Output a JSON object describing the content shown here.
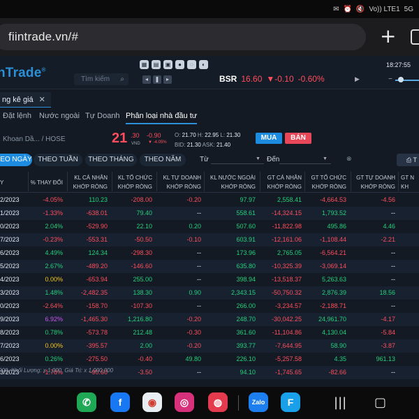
{
  "status_bar": {
    "icons": [
      "✉",
      "⏰",
      "🔇"
    ],
    "network": "Vo)) LTE1",
    "signal": "5G"
  },
  "browser": {
    "url": "fiintrade.vn/#"
  },
  "app": {
    "logo": "nTrade",
    "clock": "18:27:55",
    "search_placeholder": "Tìm kiếm",
    "ticker": {
      "symbol": "BSR",
      "price": "16.60",
      "change": "-0.10",
      "pct": "-0.60%"
    },
    "tab": "ng kê giá",
    "subnav": [
      "Đặt lệnh",
      "Nước ngoài",
      "Tự Doanh",
      "Phân loại nhà đầu tư"
    ],
    "stock": {
      "name": "Khoan Dầ...",
      "exchange": "/ HOSE",
      "price_int": "21",
      "price_dec": ".30",
      "currency": "VND",
      "change": "-0.90",
      "change_pct": "▼ -4.05%",
      "o": "21.70",
      "h": "22.95",
      "l": "21.30",
      "bid": "21.30",
      "ask": "21.40",
      "buy": "MUA",
      "sell": "BÁN"
    },
    "periods": [
      "EO NGÀY",
      "THEO TUẦN",
      "THEO THÁNG",
      "THEO NĂM"
    ],
    "from_label": "Từ",
    "to_label": "Đến",
    "print_label": "T"
  },
  "table": {
    "headers": [
      [
        "Y"
      ],
      [
        "% THAY ĐỔI"
      ],
      [
        "KL CÁ NHÂN",
        "KHỚP RÒNG"
      ],
      [
        "KL TỔ CHỨC",
        "KHỚP RÒNG"
      ],
      [
        "KL TỰ DOANH",
        "KHỚP RÒNG"
      ],
      [
        "KL NƯỚC NGOÀI",
        "KHỚP RÒNG"
      ],
      [
        "GT CÁ NHÂN",
        "KHỚP RÒNG"
      ],
      [
        "GT TỔ CHỨC",
        "KHỚP RÒNG"
      ],
      [
        "GT TỰ DOANH",
        "KHỚP RÒNG"
      ],
      [
        "GT N",
        "KH"
      ]
    ],
    "rows": [
      [
        "2/2023",
        "-4.05%",
        "110.23",
        "-208.00",
        "-0.20",
        "97.97",
        "2,558.41",
        "-4,664.53",
        "-4.56"
      ],
      [
        "1/2023",
        "-1.33%",
        "-638.01",
        "79.40",
        "--",
        "558.61",
        "-14,324.15",
        "1,793.52",
        "--"
      ],
      [
        "0/2023",
        "2.04%",
        "-529.90",
        "22.10",
        "0.20",
        "507.60",
        "-11,822.98",
        "495.86",
        "4.46"
      ],
      [
        "7/2023",
        "-0.23%",
        "-553.31",
        "-50.50",
        "-0.10",
        "603.91",
        "-12,161.06",
        "-1,108.44",
        "-2.21"
      ],
      [
        "6/2023",
        "4.49%",
        "124.34",
        "-298.30",
        "--",
        "173.96",
        "2,765.05",
        "-6,564.21",
        "--"
      ],
      [
        "5/2023",
        "2.67%",
        "-489.20",
        "-146.60",
        "--",
        "635.80",
        "-10,325.39",
        "-3,069.14",
        "--"
      ],
      [
        "4/2023",
        "0.00%",
        "-653.94",
        "255.00",
        "--",
        "398.94",
        "-13,518.37",
        "5,263.63",
        "--"
      ],
      [
        "3/2023",
        "1.48%",
        "-2,482.35",
        "138.30",
        "0.90",
        "2,343.15",
        "-50,750.32",
        "2,876.39",
        "18.56"
      ],
      [
        "0/2023",
        "-2.64%",
        "-158.70",
        "-107.30",
        "--",
        "266.00",
        "-3,234.57",
        "-2,188.71",
        "--"
      ],
      [
        "9/2023",
        "6.92%",
        "-1,465.30",
        "1,216.80",
        "-0.20",
        "248.70",
        "-30,042.25",
        "24,961.70",
        "-4.17"
      ],
      [
        "8/2023",
        "0.78%",
        "-573.78",
        "212.48",
        "-0.30",
        "361.60",
        "-11,104.86",
        "4,130.04",
        "-5.84"
      ],
      [
        "7/2023",
        "0.00%",
        "-395.57",
        "2.00",
        "-0.20",
        "393.77",
        "-7,644.95",
        "58.90",
        "-3.87"
      ],
      [
        "6/2023",
        "0.26%",
        "-275.50",
        "-0.40",
        "49.80",
        "226.10",
        "-5,257.58",
        "4.35",
        "961.13"
      ],
      [
        "3/2023",
        "-1.78%",
        "-90.60",
        "-3.50",
        "--",
        "94.10",
        "-1,745.65",
        "-82.66",
        "--"
      ]
    ],
    "footnote": "000, Khối Lượng: x 1,000. Giá Trị: x 1,000,000"
  },
  "dock": {
    "apps": [
      {
        "name": "phone-app-icon",
        "glyph": "✆",
        "color": "#1fa855"
      },
      {
        "name": "facebook-app-icon",
        "glyph": "f",
        "color": "#1877f2"
      },
      {
        "name": "chrome-app-icon",
        "glyph": "◉",
        "color": "#e9eef2"
      },
      {
        "name": "instagram-app-icon",
        "glyph": "◎",
        "color": "#d6317a"
      },
      {
        "name": "camera-app-icon",
        "glyph": "◍",
        "color": "#e43a4e"
      },
      {
        "name": "zalo-app-icon",
        "glyph": "Zalo",
        "color": "#1d7ef0"
      },
      {
        "name": "fiintrade-app-icon",
        "glyph": "F",
        "color": "#1aa0e8"
      }
    ],
    "recents_glyph": "|||",
    "home_glyph": "▢"
  }
}
